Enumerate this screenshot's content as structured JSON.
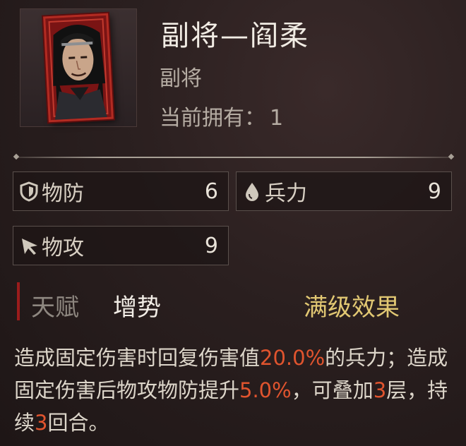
{
  "hero": {
    "title": "副将—阎柔",
    "role": "副将",
    "owned_label": "当前拥有：",
    "owned_count": "1"
  },
  "stats": [
    {
      "label": "物防",
      "value": "6",
      "icon": "shield-icon"
    },
    {
      "label": "兵力",
      "value": "9",
      "icon": "drop-icon"
    },
    {
      "label": "物攻",
      "value": "9",
      "icon": "arrowhead-icon"
    }
  ],
  "talent": {
    "label": "天赋",
    "name": "增势",
    "max_effect": "满级效果",
    "desc": {
      "p1": "造成固定伤害时回复伤害值",
      "v1": "20.0%",
      "p2": "的兵力；造成固定伤害后物攻物防提升",
      "v2": "5.0%",
      "p3": "，可叠加",
      "v3": "3",
      "p4": "层，持续",
      "v4": "3",
      "p5": "回合。"
    }
  },
  "colors": {
    "highlight": "#e0542e",
    "gold": "#e2c873",
    "card_red": "#b22b22"
  }
}
